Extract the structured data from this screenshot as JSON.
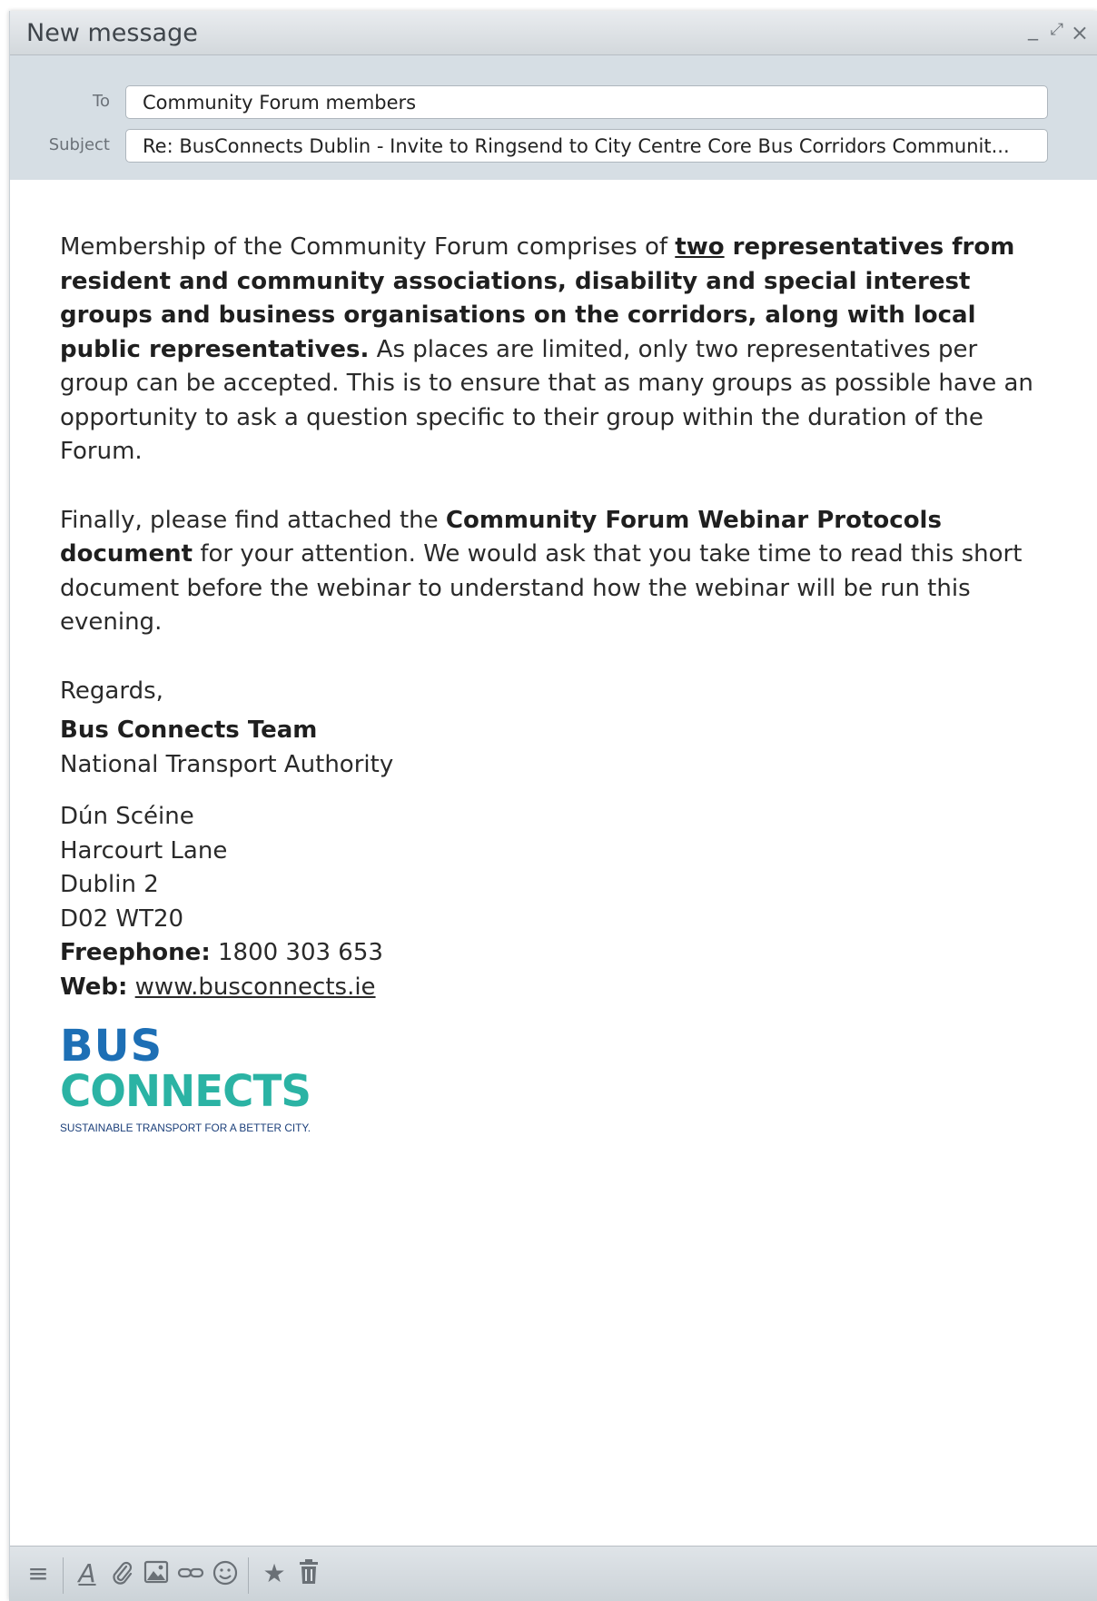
{
  "window": {
    "title": "New message",
    "controls": {
      "minimize": "_",
      "maximize": "⤢",
      "close": "×"
    }
  },
  "header": {
    "to_label": "To",
    "to_value": "Community Forum members",
    "subject_label": "Subject",
    "subject_value": "Re: BusConnects Dublin - Invite to Ringsend to City Centre Core Bus Corridors Communit..."
  },
  "body": {
    "p1_start": "Membership of the Community Forum comprises of ",
    "p1_underline": "two",
    "p1_bold": " representatives from resident and community associations, disability and special interest groups and business organisations on the corridors, along with local public representatives.",
    "p1_end": " As places are limited, only two representatives per group can be accepted. This is to ensure that as many groups as possible have an opportunity to ask a question specific to their group within the duration of the Forum.",
    "p2_start": "Finally, please find attached the ",
    "p2_bold": "Community Forum Webinar Protocols document",
    "p2_end": " for your attention. We would ask that you take time to read this short document before the webinar to understand how the webinar will be run this evening.",
    "regards": "Regards,",
    "sig_team": "Bus Connects Team",
    "sig_org": "National Transport Authority",
    "addr1": "Dún Scéine",
    "addr2": "Harcourt Lane",
    "addr3": "Dublin 2",
    "addr4": "D02 WT20",
    "freephone_label": "Freephone:",
    "freephone_value": " 1800 303 653",
    "web_label": "Web:",
    "web_value": "www.busconnects.ie"
  },
  "logo": {
    "line1": "BUS",
    "line2": "CONNECTS",
    "tagline": "SUSTAINABLE TRANSPORT FOR A BETTER CITY.",
    "colors": {
      "blue": "#1d6fb5",
      "teal": "#2bb3a4",
      "navy": "#1b3f7a",
      "sky": "#3aa6dc"
    }
  },
  "toolbar": {
    "icons": [
      "menu-icon",
      "text-format-icon",
      "attachment-icon",
      "image-icon",
      "link-icon",
      "emoji-icon",
      "star-icon",
      "trash-icon"
    ]
  }
}
